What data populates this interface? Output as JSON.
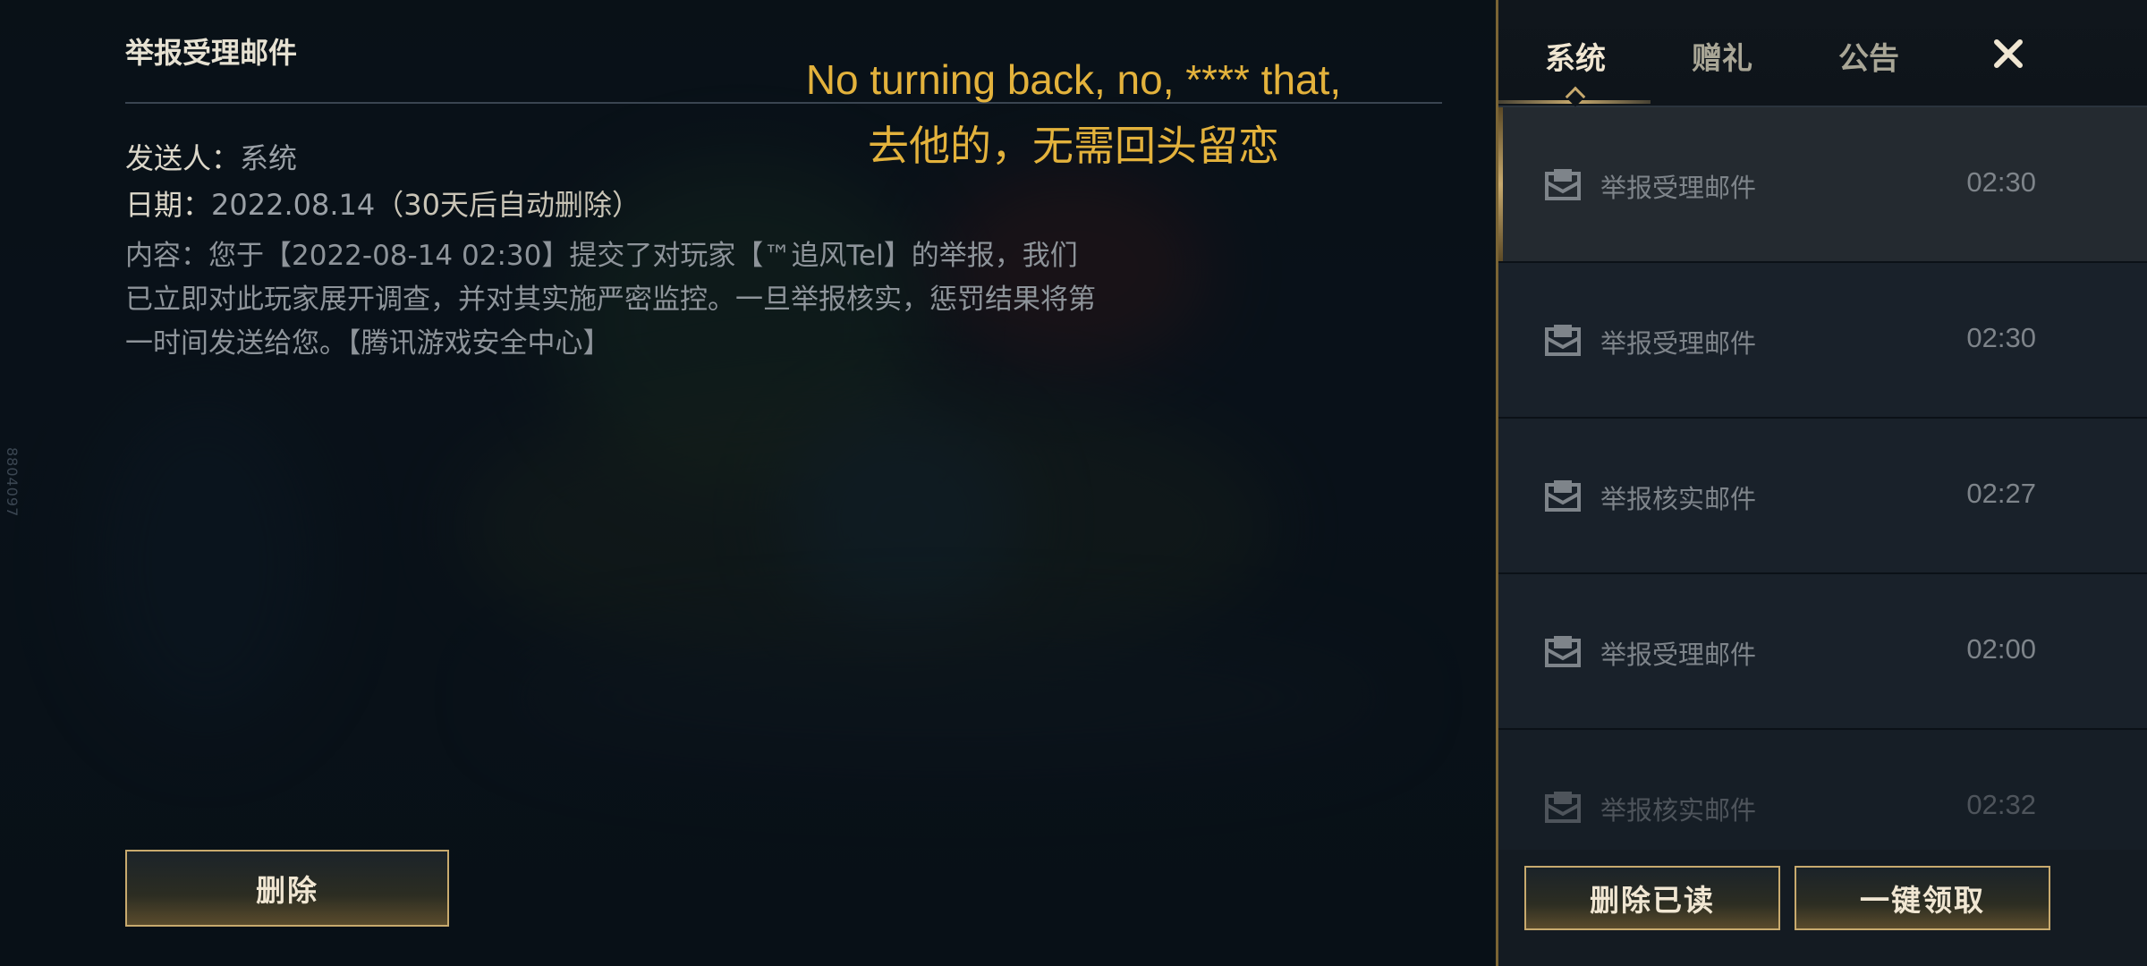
{
  "detail": {
    "title": "举报受理邮件",
    "sender_label": "发送人：",
    "sender_value": "系统",
    "date_label": "日期：",
    "date_value": "2022.08.14",
    "date_note": "（30天后自动删除）",
    "content_label": "内容：",
    "content_text": "您于【2022-08-14 02:30】提交了对玩家【™追风Tel】的举报，我们已立即对此玩家展开调查，并对其实施严密监控。一旦举报核实，惩罚结果将第一时间发送给您。【腾讯游戏安全中心】",
    "delete_label": "删除"
  },
  "subtitle": {
    "line1": "No turning back, no, **** that,",
    "line2": "去他的，无需回头留恋"
  },
  "side_number": "8804097",
  "tabs": [
    {
      "label": "系统",
      "active": true
    },
    {
      "label": "赠礼",
      "active": false
    },
    {
      "label": "公告",
      "active": false
    }
  ],
  "close_icon": "close-icon",
  "mail_list": [
    {
      "title": "举报受理邮件",
      "time": "02:30",
      "selected": true
    },
    {
      "title": "举报受理邮件",
      "time": "02:30",
      "selected": false
    },
    {
      "title": "举报核实邮件",
      "time": "02:27",
      "selected": false
    },
    {
      "title": "举报受理邮件",
      "time": "02:00",
      "selected": false
    },
    {
      "title": "举报核实邮件",
      "time": "02:32",
      "selected": false
    }
  ],
  "footer": {
    "delete_read_label": "删除已读",
    "claim_all_label": "一键领取"
  },
  "colors": {
    "accent_gold": "#c8aa6e",
    "subtitle_yellow": "#e3b23c",
    "panel_bg": "#141b22"
  }
}
